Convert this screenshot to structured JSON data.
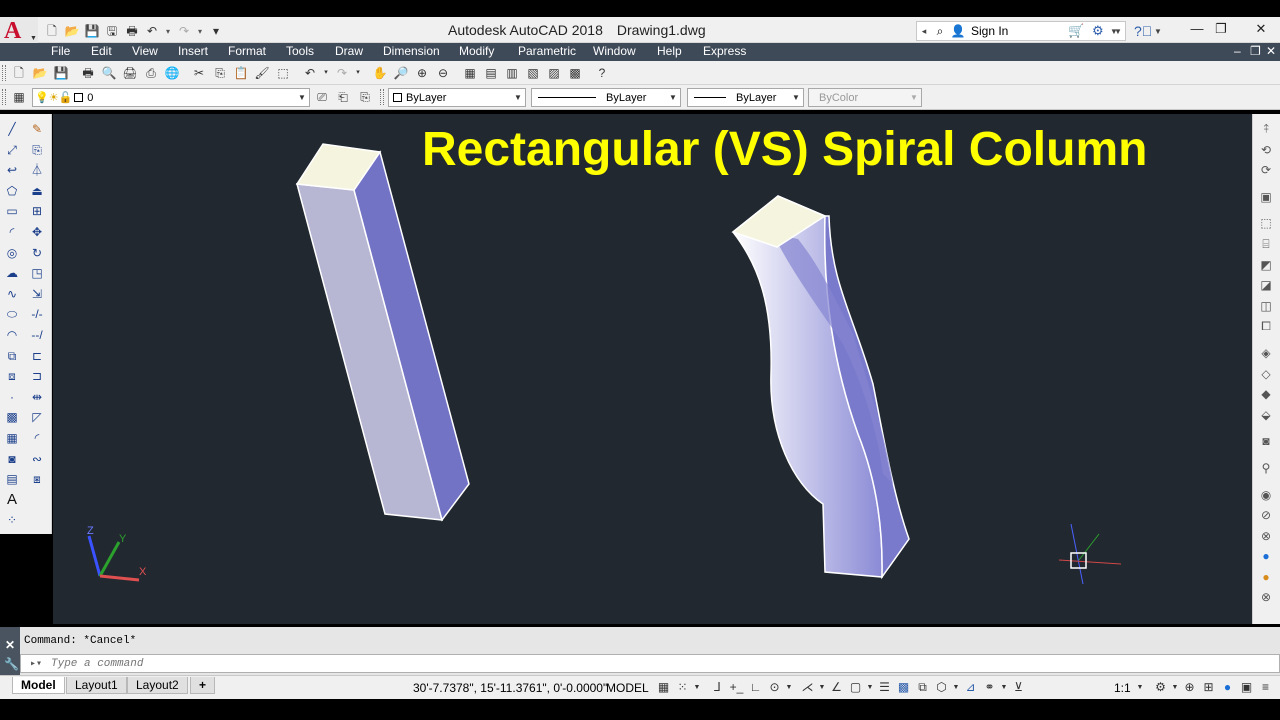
{
  "app": {
    "logo_letter": "A",
    "title": "Autodesk AutoCAD 2018",
    "document": "Drawing1.dwg",
    "sign_in": "Sign In",
    "accent": "#c8102e"
  },
  "menu": {
    "items": [
      "File",
      "Edit",
      "View",
      "Insert",
      "Format",
      "Tools",
      "Draw",
      "Dimension",
      "Modify",
      "Parametric",
      "Window",
      "Help",
      "Express"
    ]
  },
  "properties": {
    "layer": "0",
    "color": "ByLayer",
    "linetype": "ByLayer",
    "lineweight": "ByLayer",
    "plot_style": "ByColor"
  },
  "drawing": {
    "title": "Rectangular (VS) Spiral Column",
    "title_color": "#ffff00",
    "background": "#212830",
    "ucs_labels": {
      "z": "Z",
      "y": "Y",
      "x": "X"
    }
  },
  "command": {
    "history": "Command: *Cancel*",
    "placeholder": "Type a command"
  },
  "layouts": {
    "tabs": [
      "Model",
      "Layout1",
      "Layout2"
    ],
    "add": "+"
  },
  "status": {
    "coordinates": "30'-7.7378\", 15'-11.3761\", 0'-0.0000\"",
    "space": "MODEL",
    "scale": "1:1"
  }
}
